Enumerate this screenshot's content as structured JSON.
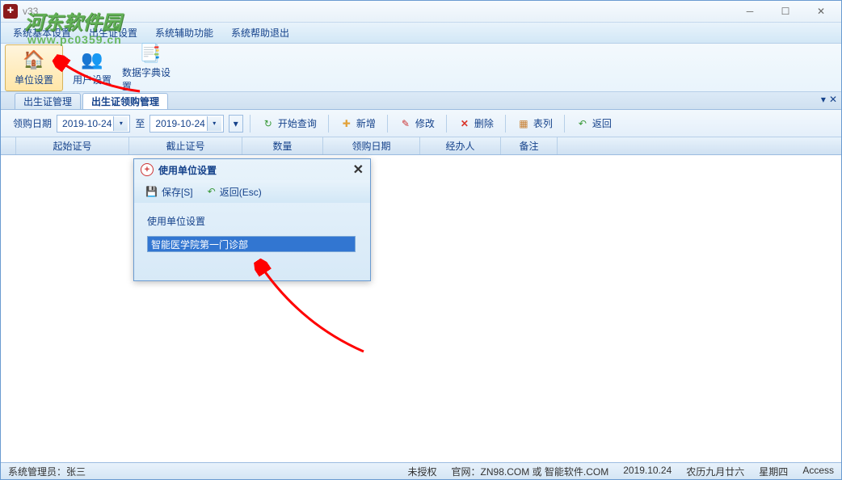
{
  "app": {
    "title": "v33"
  },
  "watermark": {
    "line1": "河东软件园",
    "line2": "www.pc0359.cn"
  },
  "menu": {
    "items": [
      "系统基本设置",
      "出生证设置",
      "系统辅助功能",
      "系统帮助退出"
    ]
  },
  "ribbon": {
    "items": [
      {
        "label": "单位设置",
        "icon": "🏠"
      },
      {
        "label": "用户设置",
        "icon": "👥"
      },
      {
        "label": "数据字典设置",
        "icon": "📑"
      }
    ]
  },
  "tabs": {
    "items": [
      "出生证管理",
      "出生证领购管理"
    ],
    "active": 1
  },
  "toolbar": {
    "date_label": "领购日期",
    "date_from": "2019-10-24",
    "to_label": "至",
    "date_to": "2019-10-24",
    "start_query": "开始查询",
    "add": "新增",
    "edit": "修改",
    "delete": "删除",
    "list": "表列",
    "back": "返回"
  },
  "grid": {
    "headers": [
      "",
      "起始证号",
      "截止证号",
      "数量",
      "领购日期",
      "经办人",
      "备注"
    ]
  },
  "dialog": {
    "title": "使用单位设置",
    "save": "保存[S]",
    "back": "返回(Esc)",
    "section": "使用单位设置",
    "value": "智能医学院第一门诊部"
  },
  "status": {
    "admin": "系统管理员：张三",
    "unauth": "未授权",
    "site": "官网：ZN98.COM 或 智能软件.COM",
    "date": "2019.10.24",
    "lunar": "农历九月廿六",
    "weekday": "星期四",
    "db": "Access"
  }
}
